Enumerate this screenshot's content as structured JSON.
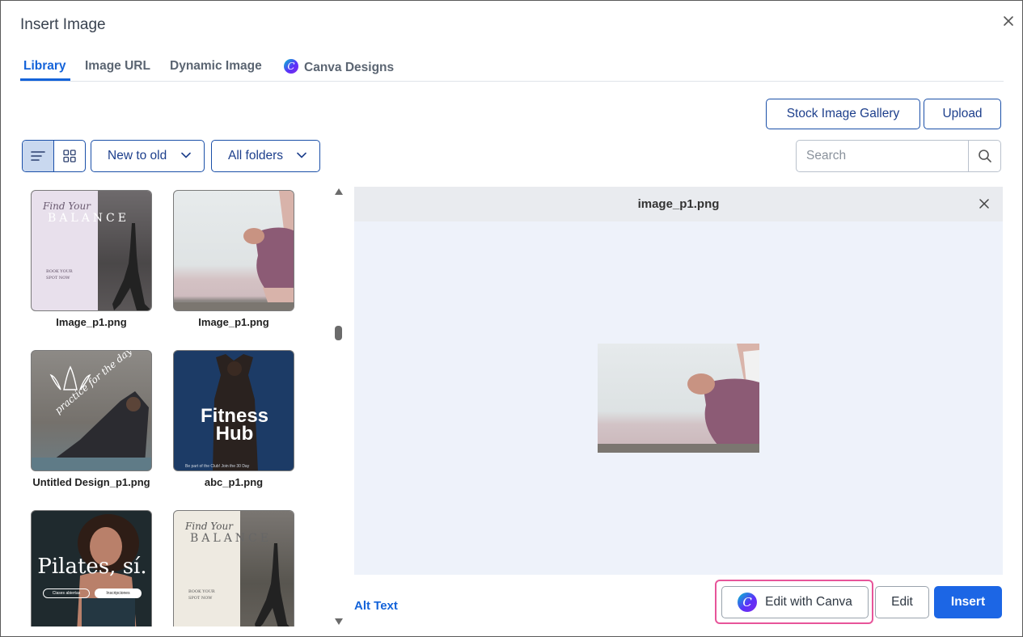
{
  "dialog": {
    "title": "Insert Image"
  },
  "tabs": [
    {
      "label": "Library",
      "active": true
    },
    {
      "label": "Image URL",
      "active": false
    },
    {
      "label": "Dynamic Image",
      "active": false
    },
    {
      "label": "Canva Designs",
      "active": false,
      "icon": "canva-icon"
    }
  ],
  "toolbar": {
    "stock_gallery_label": "Stock Image Gallery",
    "upload_label": "Upload",
    "sort_label": "New to old",
    "folder_label": "All folders",
    "search_placeholder": "Search",
    "view_mode": "list"
  },
  "library": {
    "items": [
      {
        "caption": "Image_p1.png",
        "design": "balance-poster-lilac",
        "poster": {
          "script": "Find Your",
          "big": "BALANCE",
          "lines": [
            "BOOK YOUR",
            "SPOT NOW"
          ]
        }
      },
      {
        "caption": "Image_p1.png",
        "design": "yoga-beach"
      },
      {
        "caption": "Untitled Design_p1.png",
        "design": "practice-for-the-day",
        "poster": {
          "text": "practice for the day"
        }
      },
      {
        "caption": "abc_p1.png",
        "design": "fitness-hub",
        "poster": {
          "line1": "Fitness",
          "line2": "Hub",
          "footer": "Be part of the Club! Join the 30 Day"
        }
      },
      {
        "caption": "",
        "design": "pilates",
        "poster": {
          "title": "Pilates, sí.",
          "button_left": "Clases abiertas",
          "button_right": "Inscripciones"
        }
      },
      {
        "caption": "",
        "design": "balance-poster-cream",
        "poster": {
          "script": "Find Your",
          "big": "BALANCE",
          "lines": [
            "BOOK YOUR",
            "SPOT NOW"
          ]
        }
      }
    ]
  },
  "preview": {
    "filename": "image_p1.png"
  },
  "footer": {
    "alt_text_label": "Alt Text",
    "edit_canva_label": "Edit with Canva",
    "edit_label": "Edit",
    "insert_label": "Insert"
  },
  "colors": {
    "accent": "#1463d9",
    "insert_button": "#1c66e5",
    "outline_border": "#1a4fa8",
    "highlight": "#e7559a",
    "preview_bg": "#eef2fa"
  }
}
